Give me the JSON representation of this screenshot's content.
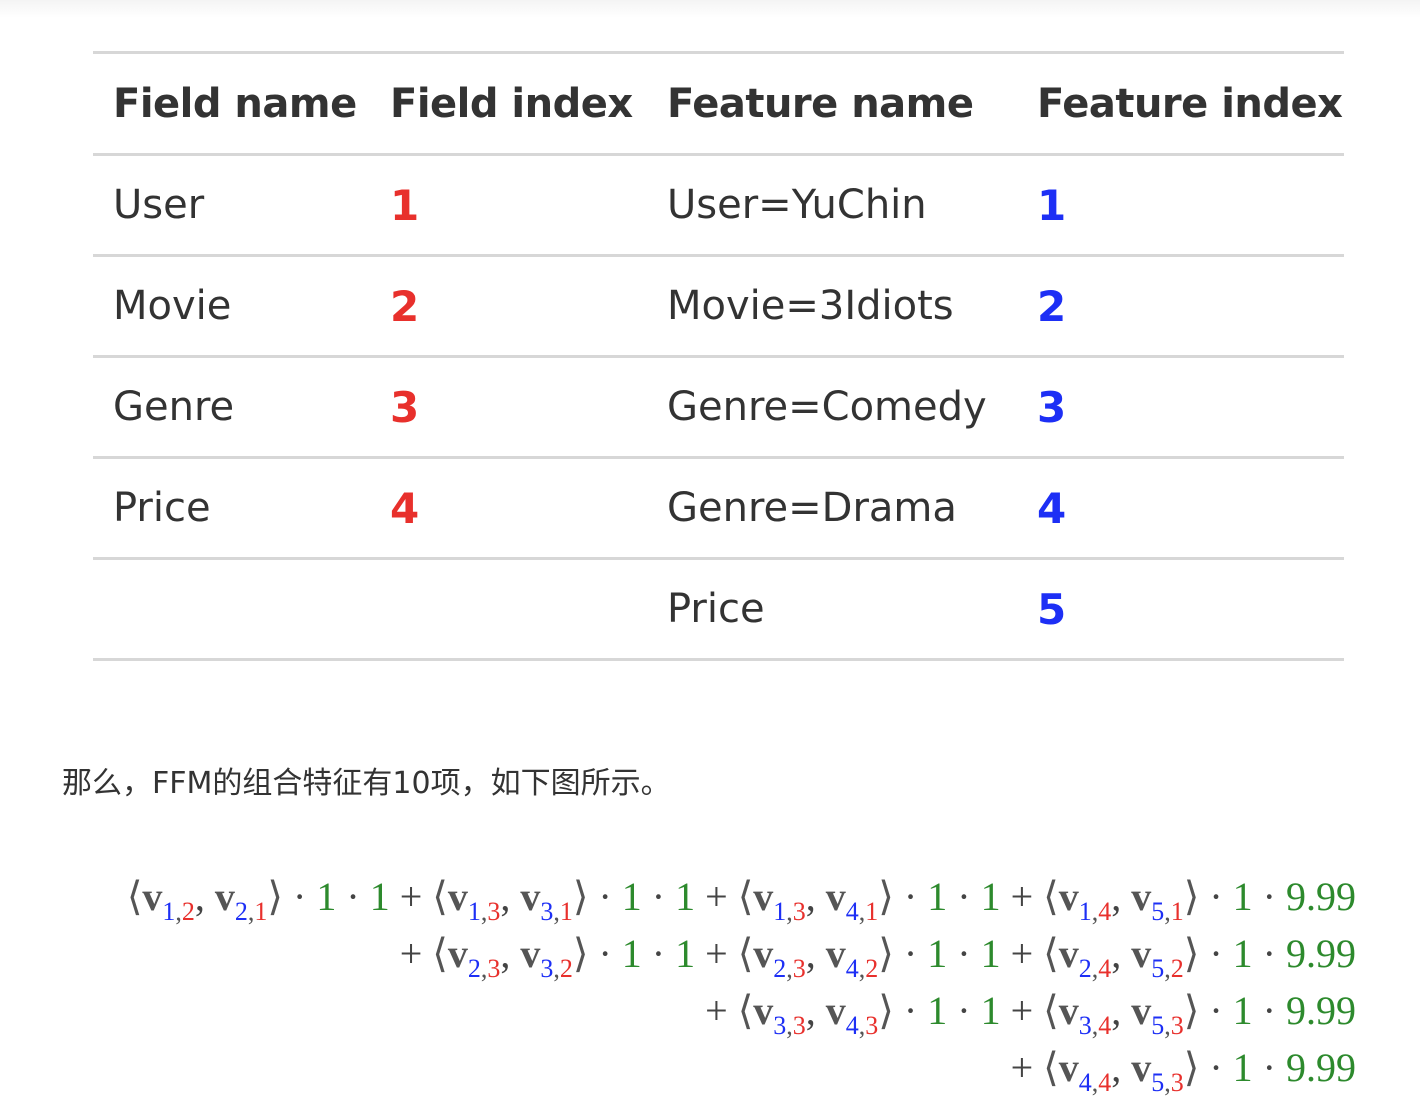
{
  "table": {
    "headers": [
      "Field name",
      "Field index",
      "Feature name",
      "Feature index"
    ],
    "rows": [
      {
        "field_name": "User",
        "field_index": "1",
        "feature_name": "User=YuChin",
        "feature_index": "1"
      },
      {
        "field_name": "Movie",
        "field_index": "2",
        "feature_name": "Movie=3Idiots",
        "feature_index": "2"
      },
      {
        "field_name": "Genre",
        "field_index": "3",
        "feature_name": "Genre=Comedy",
        "feature_index": "3"
      },
      {
        "field_name": "Price",
        "field_index": "4",
        "feature_name": "Genre=Drama",
        "feature_index": "4"
      },
      {
        "field_name": "",
        "field_index": "",
        "feature_name": "Price",
        "feature_index": "5"
      }
    ]
  },
  "paragraph": "那么，FFM的组合特征有10项，如下图所示。",
  "equation": {
    "lines": [
      {
        "leading_plus": false,
        "terms": [
          {
            "a_feat": "1",
            "a_field": "2",
            "b_feat": "2",
            "b_field": "1",
            "x1": "1",
            "x2": "1"
          },
          {
            "a_feat": "1",
            "a_field": "3",
            "b_feat": "3",
            "b_field": "1",
            "x1": "1",
            "x2": "1"
          },
          {
            "a_feat": "1",
            "a_field": "3",
            "b_feat": "4",
            "b_field": "1",
            "x1": "1",
            "x2": "1"
          },
          {
            "a_feat": "1",
            "a_field": "4",
            "b_feat": "5",
            "b_field": "1",
            "x1": "1",
            "x2": "9.99"
          }
        ]
      },
      {
        "leading_plus": true,
        "terms": [
          {
            "a_feat": "2",
            "a_field": "3",
            "b_feat": "3",
            "b_field": "2",
            "x1": "1",
            "x2": "1"
          },
          {
            "a_feat": "2",
            "a_field": "3",
            "b_feat": "4",
            "b_field": "2",
            "x1": "1",
            "x2": "1"
          },
          {
            "a_feat": "2",
            "a_field": "4",
            "b_feat": "5",
            "b_field": "2",
            "x1": "1",
            "x2": "9.99"
          }
        ]
      },
      {
        "leading_plus": true,
        "terms": [
          {
            "a_feat": "3",
            "a_field": "3",
            "b_feat": "4",
            "b_field": "3",
            "x1": "1",
            "x2": "1"
          },
          {
            "a_feat": "3",
            "a_field": "4",
            "b_feat": "5",
            "b_field": "3",
            "x1": "1",
            "x2": "9.99"
          }
        ]
      },
      {
        "leading_plus": true,
        "terms": [
          {
            "a_feat": "4",
            "a_field": "4",
            "b_feat": "5",
            "b_field": "3",
            "x1": "1",
            "x2": "9.99"
          }
        ]
      }
    ]
  },
  "colors": {
    "field_index": "#e8302c",
    "feature_index": "#1d2ff5",
    "value": "#2d8a2d",
    "text": "#333333",
    "rule": "#d7d7d7"
  }
}
